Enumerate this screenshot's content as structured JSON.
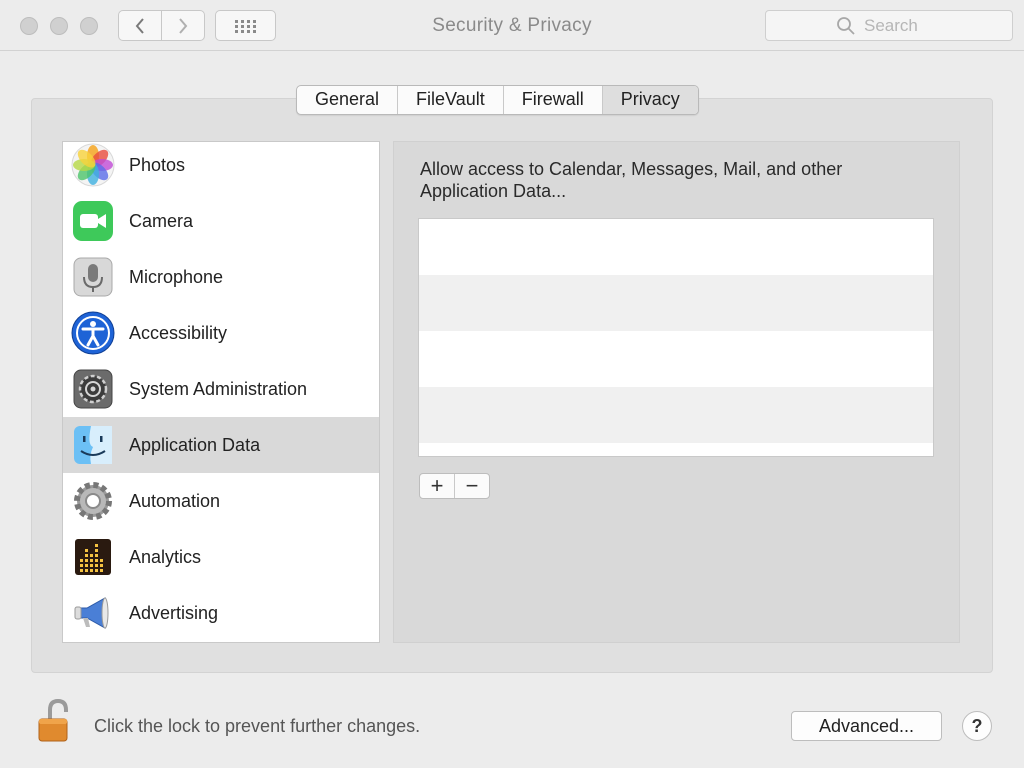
{
  "window": {
    "title": "Security & Privacy"
  },
  "search": {
    "placeholder": "Search"
  },
  "tabs": [
    {
      "label": "General"
    },
    {
      "label": "FileVault"
    },
    {
      "label": "Firewall"
    },
    {
      "label": "Privacy",
      "active": true
    }
  ],
  "categories": [
    {
      "label": "Photos",
      "icon": "photos-icon"
    },
    {
      "label": "Camera",
      "icon": "camera-icon"
    },
    {
      "label": "Microphone",
      "icon": "microphone-icon"
    },
    {
      "label": "Accessibility",
      "icon": "accessibility-icon"
    },
    {
      "label": "System Administration",
      "icon": "system-admin-icon"
    },
    {
      "label": "Application Data",
      "icon": "finder-icon",
      "selected": true
    },
    {
      "label": "Automation",
      "icon": "gear-icon"
    },
    {
      "label": "Analytics",
      "icon": "analytics-icon"
    },
    {
      "label": "Advertising",
      "icon": "megaphone-icon"
    }
  ],
  "detail": {
    "description": "Allow access to Calendar, Messages, Mail, and other Application Data...",
    "apps": [],
    "add_label": "+",
    "remove_label": "−"
  },
  "footer": {
    "lock_text": "Click the lock to prevent further changes.",
    "advanced_label": "Advanced...",
    "help_label": "?"
  },
  "colors": {
    "window_bg": "#ececec",
    "selected_row": "#d9d9d9",
    "lock_orange": "#e08a2e",
    "camera_green": "#3ec95a",
    "accessibility_blue": "#1e63d6"
  }
}
